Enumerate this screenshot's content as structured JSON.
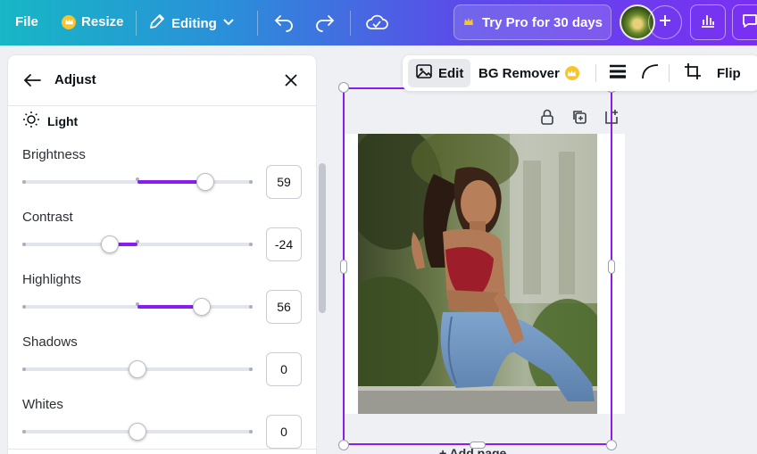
{
  "topbar": {
    "file_label": "File",
    "resize_label": "Resize",
    "editing_label": "Editing",
    "pro_label": "Try Pro for 30 days",
    "icons": [
      "crown-icon",
      "pencil-icon",
      "chevron-down-icon",
      "undo-icon",
      "redo-icon",
      "cloud-check-icon",
      "plus-icon",
      "chart-icon",
      "comment-icon"
    ]
  },
  "panel": {
    "title": "Adjust",
    "section": "Light",
    "adjustments": [
      {
        "label": "Brightness",
        "value": "59",
        "level": 59
      },
      {
        "label": "Contrast",
        "value": "-24",
        "level": -24
      },
      {
        "label": "Highlights",
        "value": "56",
        "level": 56
      },
      {
        "label": "Shadows",
        "value": "0",
        "level": 0
      },
      {
        "label": "Whites",
        "value": "0",
        "level": 0
      }
    ]
  },
  "toolbar": {
    "edit_label": "Edit",
    "bg_remover_label": "BG Remover",
    "flip_label": "Flip"
  },
  "canvas": {
    "add_page_label": "+ Add page"
  },
  "colors": {
    "accent": "#8b1cf0",
    "topbar_start": "#17b7c5",
    "topbar_end": "#7b2ff2",
    "pro_crown": "#f7c52a"
  }
}
